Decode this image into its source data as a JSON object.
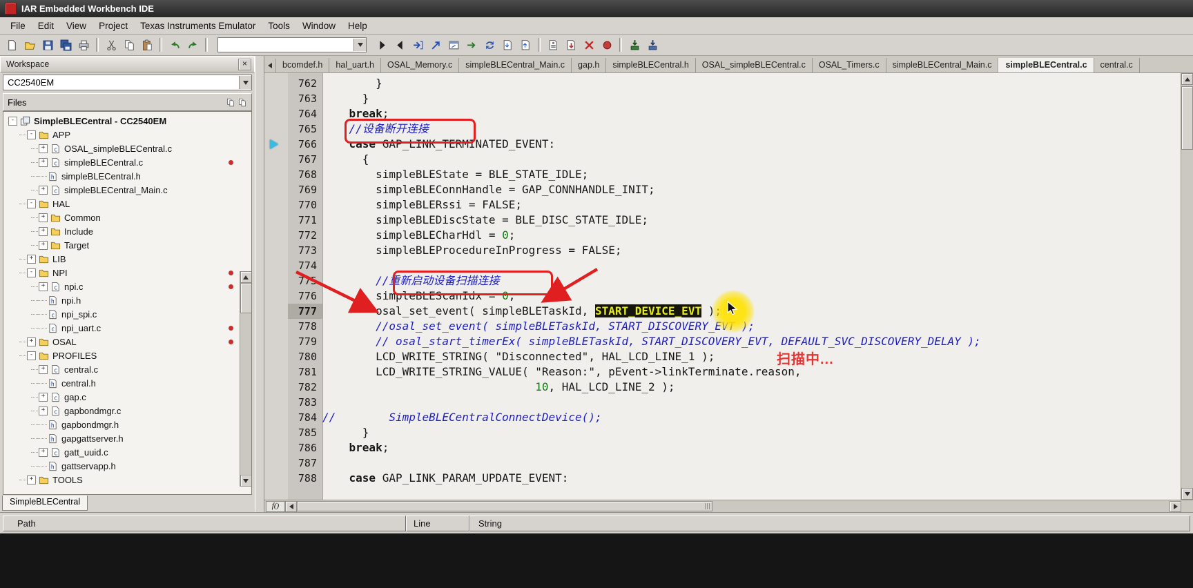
{
  "window": {
    "title": "IAR Embedded Workbench IDE"
  },
  "menu": {
    "items": [
      "File",
      "Edit",
      "View",
      "Project",
      "Texas Instruments Emulator",
      "Tools",
      "Window",
      "Help"
    ]
  },
  "toolbar": {
    "search_value": "",
    "icons": [
      "new-document",
      "open-file",
      "save",
      "save-all",
      "print",
      "sep",
      "cut",
      "copy",
      "paste",
      "sep",
      "undo",
      "redo",
      "sep",
      "combo",
      "find-next",
      "find-previous",
      "find-in-files",
      "replace-in-files",
      "goto-line",
      "open-header",
      "refresh",
      "next-bookmark",
      "prev-bookmark",
      "sep",
      "compile",
      "make",
      "stop-build",
      "toggle-breakpoint",
      "sep",
      "download-debug",
      "debug-without-download"
    ]
  },
  "workspace": {
    "title": "Workspace",
    "close_label": "×",
    "target_dropdown": "CC2540EM",
    "files_header": "Files",
    "bottom_tab": "SimpleBLECentral",
    "tree": [
      {
        "l": "SimpleBLECentral - CC2540EM",
        "d": 0,
        "b": "-",
        "i": "project",
        "bold": true
      },
      {
        "l": "APP",
        "d": 1,
        "b": "-",
        "i": "folder"
      },
      {
        "l": "OSAL_simpleBLECentral.c",
        "d": 2,
        "b": "+",
        "i": "cfile"
      },
      {
        "l": "simpleBLECentral.c",
        "d": 2,
        "b": "+",
        "i": "cfile",
        "dot": true
      },
      {
        "l": "simpleBLECentral.h",
        "d": 2,
        "b": "",
        "i": "hfile"
      },
      {
        "l": "simpleBLECentral_Main.c",
        "d": 2,
        "b": "+",
        "i": "cfile"
      },
      {
        "l": "HAL",
        "d": 1,
        "b": "-",
        "i": "folder"
      },
      {
        "l": "Common",
        "d": 2,
        "b": "+",
        "i": "folder"
      },
      {
        "l": "Include",
        "d": 2,
        "b": "+",
        "i": "folder"
      },
      {
        "l": "Target",
        "d": 2,
        "b": "+",
        "i": "folder"
      },
      {
        "l": "LIB",
        "d": 1,
        "b": "+",
        "i": "folder"
      },
      {
        "l": "NPI",
        "d": 1,
        "b": "-",
        "i": "folder",
        "dot": true
      },
      {
        "l": "npi.c",
        "d": 2,
        "b": "+",
        "i": "cfile",
        "dot": true
      },
      {
        "l": "npi.h",
        "d": 2,
        "b": "",
        "i": "hfile"
      },
      {
        "l": "npi_spi.c",
        "d": 2,
        "b": "",
        "i": "cfile"
      },
      {
        "l": "npi_uart.c",
        "d": 2,
        "b": "",
        "i": "cfile",
        "dot": true
      },
      {
        "l": "OSAL",
        "d": 1,
        "b": "+",
        "i": "folder",
        "dot": true
      },
      {
        "l": "PROFILES",
        "d": 1,
        "b": "-",
        "i": "folder"
      },
      {
        "l": "central.c",
        "d": 2,
        "b": "+",
        "i": "cfile"
      },
      {
        "l": "central.h",
        "d": 2,
        "b": "",
        "i": "hfile"
      },
      {
        "l": "gap.c",
        "d": 2,
        "b": "+",
        "i": "cfile"
      },
      {
        "l": "gapbondmgr.c",
        "d": 2,
        "b": "+",
        "i": "cfile"
      },
      {
        "l": "gapbondmgr.h",
        "d": 2,
        "b": "",
        "i": "hfile"
      },
      {
        "l": "gapgattserver.h",
        "d": 2,
        "b": "",
        "i": "hfile"
      },
      {
        "l": "gatt_uuid.c",
        "d": 2,
        "b": "+",
        "i": "cfile"
      },
      {
        "l": "gattservapp.h",
        "d": 2,
        "b": "",
        "i": "hfile"
      },
      {
        "l": "TOOLS",
        "d": 1,
        "b": "+",
        "i": "folder"
      }
    ]
  },
  "editor": {
    "function_button": "f()",
    "tab_list": [
      {
        "label": "bcomdef.h"
      },
      {
        "label": "hal_uart.h"
      },
      {
        "label": "OSAL_Memory.c"
      },
      {
        "label": "simpleBLECentral_Main.c"
      },
      {
        "label": "gap.h"
      },
      {
        "label": "simpleBLECentral.h"
      },
      {
        "label": "OSAL_simpleBLECentral.c"
      },
      {
        "label": "OSAL_Timers.c"
      },
      {
        "label": "simpleBLECentral_Main.c"
      },
      {
        "label": "simpleBLECentral.c",
        "active": true
      },
      {
        "label": "central.c"
      }
    ],
    "lines": [
      {
        "n": 762,
        "seg": [
          [
            "p",
            "        }"
          ]
        ]
      },
      {
        "n": 763,
        "seg": [
          [
            "p",
            "      }"
          ]
        ]
      },
      {
        "n": 764,
        "seg": [
          [
            "p",
            "    "
          ],
          [
            "k",
            "break"
          ],
          [
            "p",
            ";"
          ]
        ]
      },
      {
        "n": 765,
        "seg": [
          [
            "p",
            "    "
          ],
          [
            "c",
            "//设备断开连接"
          ]
        ]
      },
      {
        "n": 766,
        "seg": [
          [
            "p",
            "    "
          ],
          [
            "k",
            "case"
          ],
          [
            "p",
            " GAP_LINK_TERMINATED_EVENT:"
          ]
        ]
      },
      {
        "n": 767,
        "seg": [
          [
            "p",
            "      {"
          ]
        ]
      },
      {
        "n": 768,
        "seg": [
          [
            "p",
            "        simpleBLEState = BLE_STATE_IDLE;"
          ]
        ]
      },
      {
        "n": 769,
        "seg": [
          [
            "p",
            "        simpleBLEConnHandle = GAP_CONNHANDLE_INIT;"
          ]
        ]
      },
      {
        "n": 770,
        "seg": [
          [
            "p",
            "        simpleBLERssi = FALSE;"
          ]
        ]
      },
      {
        "n": 771,
        "seg": [
          [
            "p",
            "        simpleBLEDiscState = BLE_DISC_STATE_IDLE;"
          ]
        ]
      },
      {
        "n": 772,
        "seg": [
          [
            "p",
            "        simpleBLECharHdl = "
          ],
          [
            "num",
            "0"
          ],
          [
            "p",
            ";"
          ]
        ]
      },
      {
        "n": 773,
        "seg": [
          [
            "p",
            "        simpleBLEProcedureInProgress = FALSE;"
          ]
        ]
      },
      {
        "n": 774,
        "seg": []
      },
      {
        "n": 775,
        "seg": [
          [
            "p",
            "        "
          ],
          [
            "c",
            "//重新启动设备扫描连接"
          ]
        ]
      },
      {
        "n": 776,
        "seg": [
          [
            "p",
            "        simpleBLEScanIdx = "
          ],
          [
            "num",
            "0"
          ],
          [
            "p",
            ";"
          ]
        ]
      },
      {
        "n": 777,
        "hl": true,
        "seg": [
          [
            "p",
            "        osal_set_event( simpleBLETaskId, "
          ],
          [
            "sel",
            "START_DEVICE_EVT"
          ],
          [
            "p",
            " );"
          ]
        ]
      },
      {
        "n": 778,
        "seg": [
          [
            "p",
            "        "
          ],
          [
            "c",
            "//osal_set_event( simpleBLETaskId, START_DISCOVERY_EVT );"
          ]
        ]
      },
      {
        "n": 779,
        "seg": [
          [
            "p",
            "        "
          ],
          [
            "c",
            "// osal_start_timerEx( simpleBLETaskId, START_DISCOVERY_EVT, DEFAULT_SVC_DISCOVERY_DELAY );"
          ]
        ]
      },
      {
        "n": 780,
        "seg": [
          [
            "p",
            "        LCD_WRITE_STRING( \"Disconnected\", HAL_LCD_LINE_1 );"
          ]
        ]
      },
      {
        "n": 781,
        "seg": [
          [
            "p",
            "        LCD_WRITE_STRING_VALUE( \"Reason:\", pEvent->linkTerminate.reason,"
          ]
        ]
      },
      {
        "n": 782,
        "seg": [
          [
            "p",
            "                                "
          ],
          [
            "num",
            "10"
          ],
          [
            "p",
            ", HAL_LCD_LINE_2 );"
          ]
        ]
      },
      {
        "n": 783,
        "seg": []
      },
      {
        "n": 784,
        "seg": [
          [
            "c",
            "//        SimpleBLECentralConnectDevice();"
          ]
        ]
      },
      {
        "n": 785,
        "seg": [
          [
            "p",
            "      }"
          ]
        ]
      },
      {
        "n": 786,
        "seg": [
          [
            "p",
            "    "
          ],
          [
            "k",
            "break"
          ],
          [
            "p",
            ";"
          ]
        ]
      },
      {
        "n": 787,
        "seg": []
      },
      {
        "n": 788,
        "seg": [
          [
            "p",
            "    "
          ],
          [
            "k",
            "case"
          ],
          [
            "p",
            " GAP_LINK_PARAM_UPDATE_EVENT:"
          ]
        ]
      }
    ],
    "overlay": {
      "scanning_label": "扫描中..."
    }
  },
  "findbar": {
    "columns": [
      "Path",
      "Line",
      "String"
    ]
  }
}
